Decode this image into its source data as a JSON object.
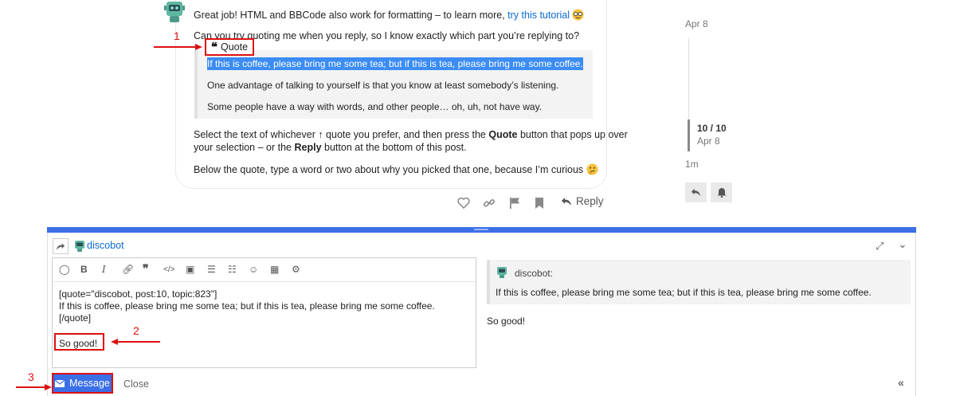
{
  "post": {
    "line1_prefix": "Great job! HTML and BBCode also work for formatting – to learn more,",
    "line1_link": "try this tutorial",
    "line2": "Can you try quoting me when you reply, so I know exactly which part you’re replying to?",
    "quote_button_label": "Quote",
    "quotes": [
      "If this is coffee, please bring me some tea; but if this is tea, please bring me some coffee.",
      "One advantage of talking to yourself is that you know at least somebody’s listening.",
      "Some people have a way with words, and other people… oh, uh, not have way."
    ],
    "instr_a": "Select the text of whichever ↑ quote you prefer, and then press the",
    "instr_quote": "Quote",
    "instr_b": "button that pops up over",
    "instr_c": "your selection – or the",
    "instr_reply": "Reply",
    "instr_d": "button at the bottom of this post.",
    "below_line": "Below the quote, type a word or two about why you picked that one, because I’m curious",
    "reply_label": "Reply"
  },
  "annotations": {
    "one": "1",
    "two": "2",
    "three": "3"
  },
  "timeline": {
    "top_date": "Apr 8",
    "position": "10 / 10",
    "current_date": "Apr 8",
    "age": "1m"
  },
  "composer": {
    "username": "discobot",
    "editor_lines": [
      "[quote=\"discobot, post:10, topic:823\"]",
      "If this is coffee, please bring me some tea; but if this is tea, please bring me some coffee.",
      "[/quote]",
      "So good!"
    ],
    "preview_author": "discobot:",
    "preview_quote": "If this is coffee, please bring me some tea; but if this is tea, please bring me some coffee.",
    "preview_body": "So good!",
    "message_button": "Message",
    "close_label": "Close"
  },
  "colors": {
    "accent": "#3a6fe6",
    "annotation": "#dd1111",
    "selection": "#3b8cf5",
    "link": "#0a6cd6"
  }
}
